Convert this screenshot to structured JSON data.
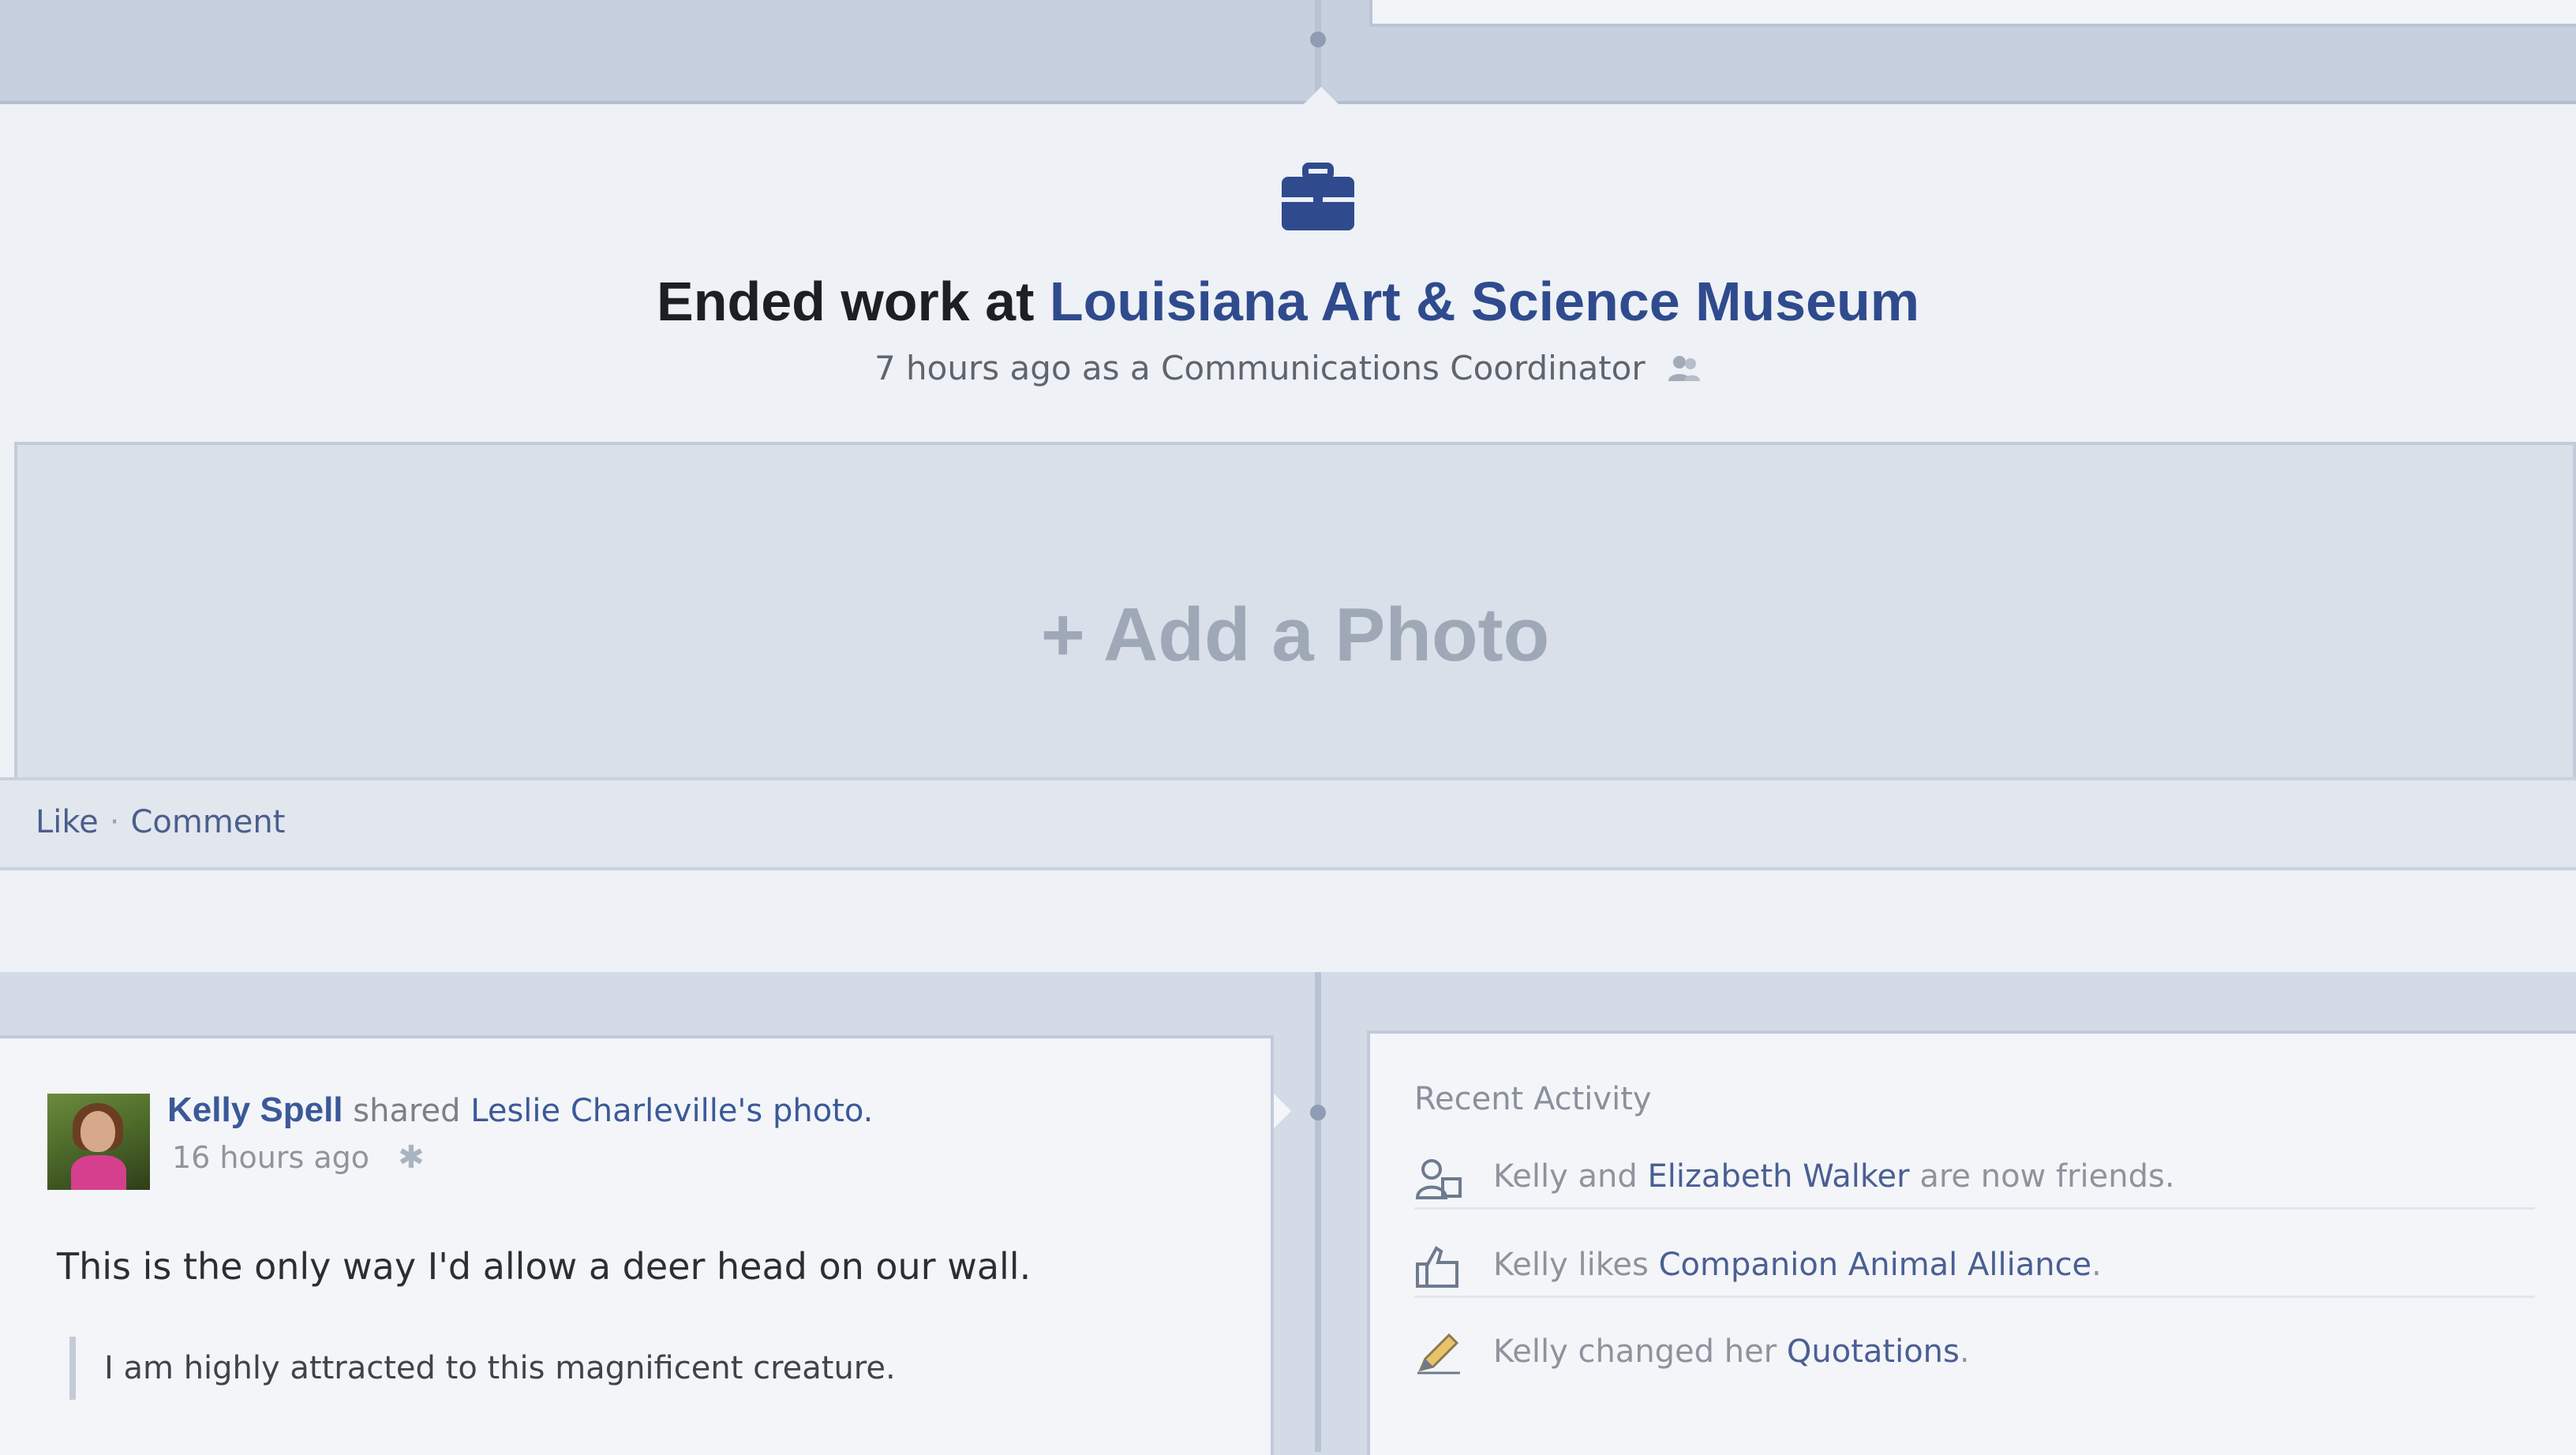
{
  "life_event": {
    "title_prefix": "Ended work at",
    "organization": "Louisiana Art & Science Museum",
    "subtitle": "7 hours ago as a Communications Coordinator",
    "audience_icon": "friends-icon",
    "event_icon": "briefcase-icon"
  },
  "photo_box": {
    "label": "+ Add a Photo"
  },
  "actions": {
    "like": "Like",
    "separator": "·",
    "comment": "Comment"
  },
  "post": {
    "author": "Kelly Spell",
    "action_text": "shared",
    "shared_source": "Leslie Charleville's photo.",
    "time": "16 hours ago",
    "body": "This is the only way I'd allow a deer head on our wall.",
    "quote": "I am highly attracted to this magnificent creature."
  },
  "recent_activity": {
    "title": "Recent Activity",
    "items": [
      {
        "icon": "friends-icon",
        "pre": "Kelly and",
        "link": "Elizabeth Walker",
        "post": "are now friends."
      },
      {
        "icon": "like-thumb-icon",
        "pre": "Kelly likes",
        "link": "Companion Animal Alliance",
        "post": "."
      },
      {
        "icon": "pencil-icon",
        "pre": "Kelly changed her",
        "link": "Quotations",
        "post": "."
      }
    ]
  },
  "colors": {
    "link_blue": "#2f4b8e",
    "background": "#d3dbe7",
    "card": "#eef1f5"
  }
}
